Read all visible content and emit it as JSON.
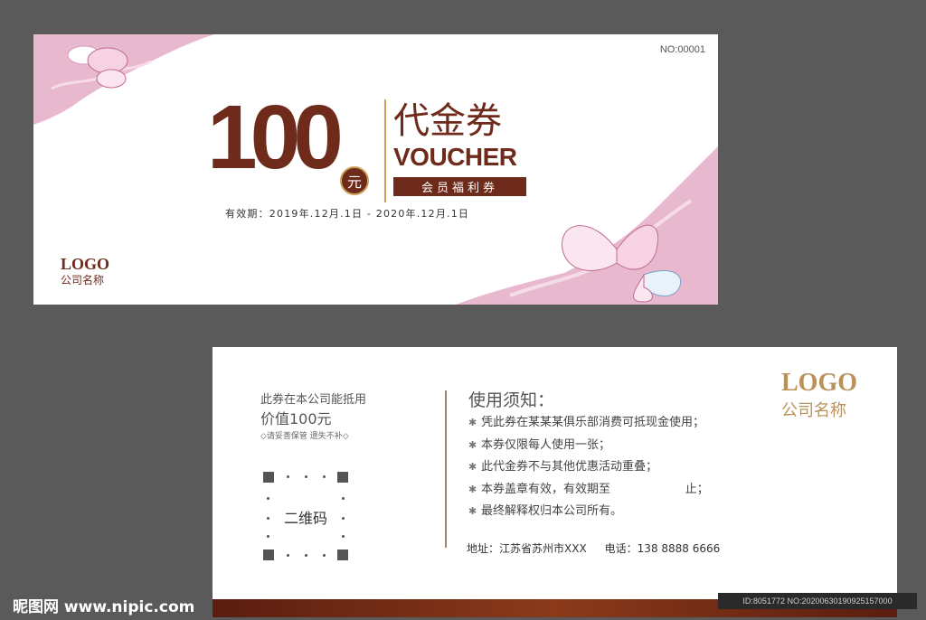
{
  "front": {
    "number": "NO:00001",
    "amount": "100",
    "unit": "元",
    "title_cn": "代金券",
    "title_en": "VOUCHER",
    "member_label": "会员福利券",
    "validity": "有效期：2019年.12月.1日 - 2020年.12月.1日",
    "logo": "LOGO",
    "company": "公司名称"
  },
  "back": {
    "value_line1": "此券在本公司能抵用",
    "value_line2": "价值100元",
    "keep_note": "◇请妥善保管 遗失不补◇",
    "qr_label": "二维码",
    "notice_title": "使用须知：",
    "notices": [
      "凭此券在某某某俱乐部消费可抵现金使用；",
      "本券仅限每人使用一张；",
      "此代金券不与其他优惠活动重叠；",
      "本券盖章有效，有效期至                    止；",
      "最终解释权归本公司所有。"
    ],
    "address": "地址：江苏省苏州市XXX",
    "phone": "电话：138 8888 6666",
    "logo": "LOGO",
    "company": "公司名称"
  },
  "watermark": "昵图网 www.nipic.com",
  "image_id": "ID:8051772 NO:20200630190925157000",
  "colors": {
    "brand_brown": "#6e2a1a",
    "gold": "#c9a35a",
    "pink": "#e8b8cf"
  }
}
